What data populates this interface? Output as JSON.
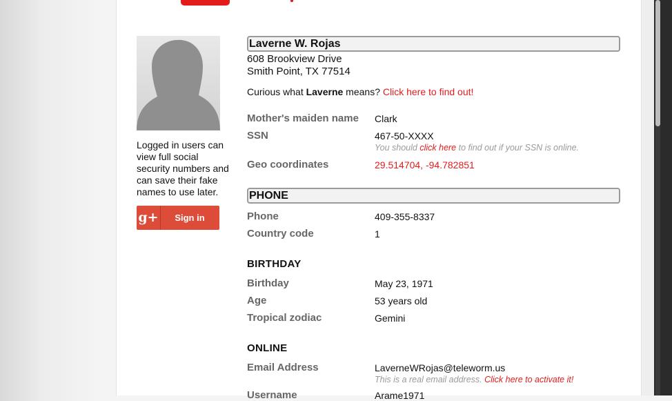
{
  "identity": {
    "name": "Laverne W. Rojas",
    "address_line1": "608 Brookview Drive",
    "address_line2": "Smith Point, TX 77514",
    "curious_prefix": "Curious what ",
    "first_name": "Laverne",
    "curious_suffix": " means? ",
    "curious_link": "Click here to find out!"
  },
  "fields": {
    "maiden_label": "Mother's maiden name",
    "maiden_value": "Clark",
    "ssn_label": "SSN",
    "ssn_value": "467-50-XXXX",
    "ssn_hint_prefix": "You should ",
    "ssn_hint_link": "click here",
    "ssn_hint_suffix": " to find out if your SSN is online.",
    "geo_label": "Geo coordinates",
    "geo_value": "29.514704, -94.782851"
  },
  "phone_section": {
    "title": "PHONE",
    "phone_label": "Phone",
    "phone_value": "409-355-8337",
    "country_label": "Country code",
    "country_value": "1"
  },
  "birthday_section": {
    "title": "BIRTHDAY",
    "birthday_label": "Birthday",
    "birthday_value": "May 23, 1971",
    "age_label": "Age",
    "age_value": "53 years old",
    "zodiac_label": "Tropical zodiac",
    "zodiac_value": "Gemini"
  },
  "online_section": {
    "title": "ONLINE",
    "email_label": "Email Address",
    "email_value": "LaverneWRojas@teleworm.us",
    "email_hint_prefix": "This is a real email address. ",
    "email_hint_link": "Click here to activate it!",
    "username_label": "Username",
    "username_value": "Arame1971"
  },
  "sidebar": {
    "login_note": "Logged in users can view full social security numbers and can save their fake names to use later.",
    "gplus_logo": "g+",
    "signin_label": "Sign in"
  },
  "colors": {
    "accent_red": "#e21c1c",
    "google_red": "#dd4b39",
    "label_gray": "#666666"
  }
}
